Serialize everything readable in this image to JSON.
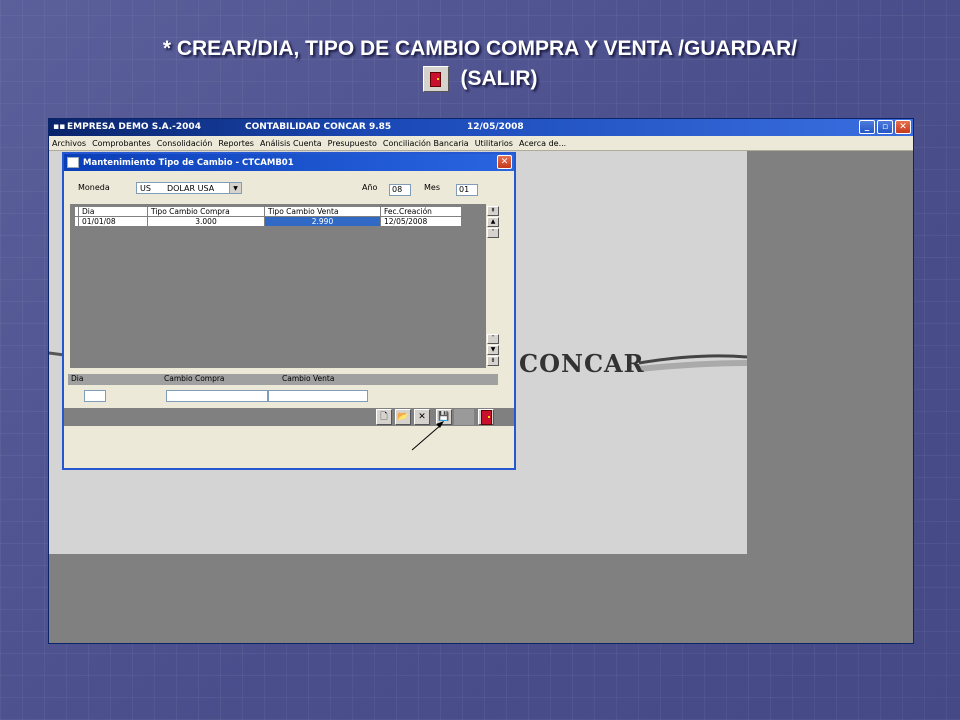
{
  "slide": {
    "title_line1": "* CREAR/DIA, TIPO DE CAMBIO COMPRA Y VENTA /GUARDAR/",
    "title_line2": "(SALIR)"
  },
  "app": {
    "company": "EMPRESA DEMO S.A.-2004",
    "product": "CONTABILIDAD CONCAR 9.85",
    "date": "12/05/2008",
    "logo_text": "CONCAR",
    "menu": [
      "Archivos",
      "Comprobantes",
      "Consolidación",
      "Reportes",
      "Análisis Cuenta",
      "Presupuesto",
      "Conciliación Bancaria",
      "Utilitarios",
      "Acerca de..."
    ]
  },
  "dialog": {
    "title": "Mantenimiento Tipo de Cambio - CTCAMB01",
    "moneda_label": "Moneda",
    "moneda_code": "US",
    "moneda_name": "DOLAR USA",
    "anio_label": "Año",
    "anio_value": "08",
    "mes_label": "Mes",
    "mes_value": "01",
    "grid": {
      "headers": [
        "Dia",
        "Tipo Cambio Compra",
        "Tipo Cambio Venta",
        "Fec.Creación"
      ],
      "rows": [
        {
          "dia": "01/01/08",
          "compra": "3.000",
          "venta": "2.990",
          "fecha": "12/05/2008"
        }
      ]
    },
    "edit_labels": {
      "dia": "Dia",
      "compra": "Cambio Compra",
      "venta": "Cambio Venta"
    }
  },
  "icons": [
    "app-icon",
    "minimize-icon",
    "maximize-icon",
    "close-icon",
    "new-icon",
    "open-icon",
    "delete-icon",
    "save-icon",
    "exit-icon"
  ]
}
